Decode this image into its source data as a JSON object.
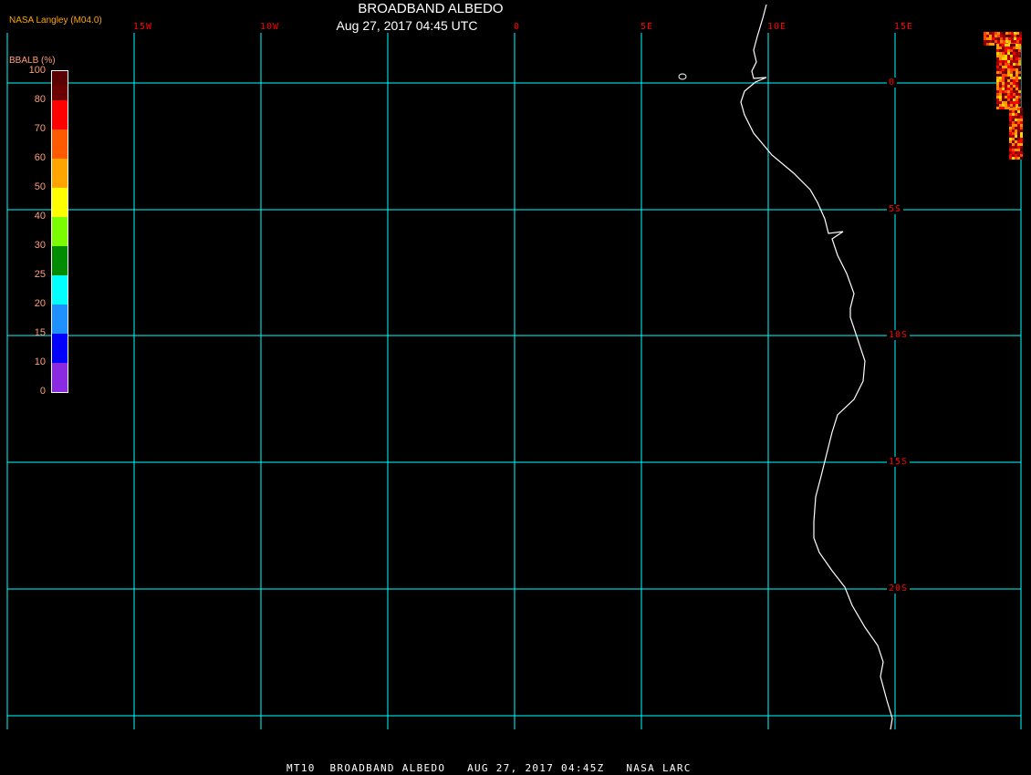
{
  "header": {
    "title": "BROADBAND ALBEDO",
    "subtitle": "Aug 27, 2017 04:45 UTC",
    "source": "NASA Langley (M04.0)"
  },
  "grid": {
    "color": "#00ffff",
    "label_color": "#ff0000",
    "lon_labels": [
      "15W",
      "10W",
      "0",
      "5E",
      "10E",
      "15E"
    ],
    "lat_labels": [
      "0",
      "5S",
      "10S",
      "15S",
      "20S"
    ]
  },
  "colorbar": {
    "title": "BBALB (%)",
    "labels": [
      "100",
      "80",
      "70",
      "60",
      "50",
      "40",
      "30",
      "25",
      "20",
      "15",
      "10",
      "0"
    ],
    "colors": [
      "#5a0000",
      "#6b0000",
      "#ff0000",
      "#ff5a00",
      "#ffa500",
      "#ffff00",
      "#7cfc00",
      "#008b00",
      "#00ffff",
      "#1e90ff",
      "#0000ff",
      "#8a2be2"
    ]
  },
  "coast_color": "#ffffff",
  "footer": {
    "text": "MT10  BROADBAND ALBEDO   AUG 27, 2017 04:45Z   NASA LARC"
  }
}
